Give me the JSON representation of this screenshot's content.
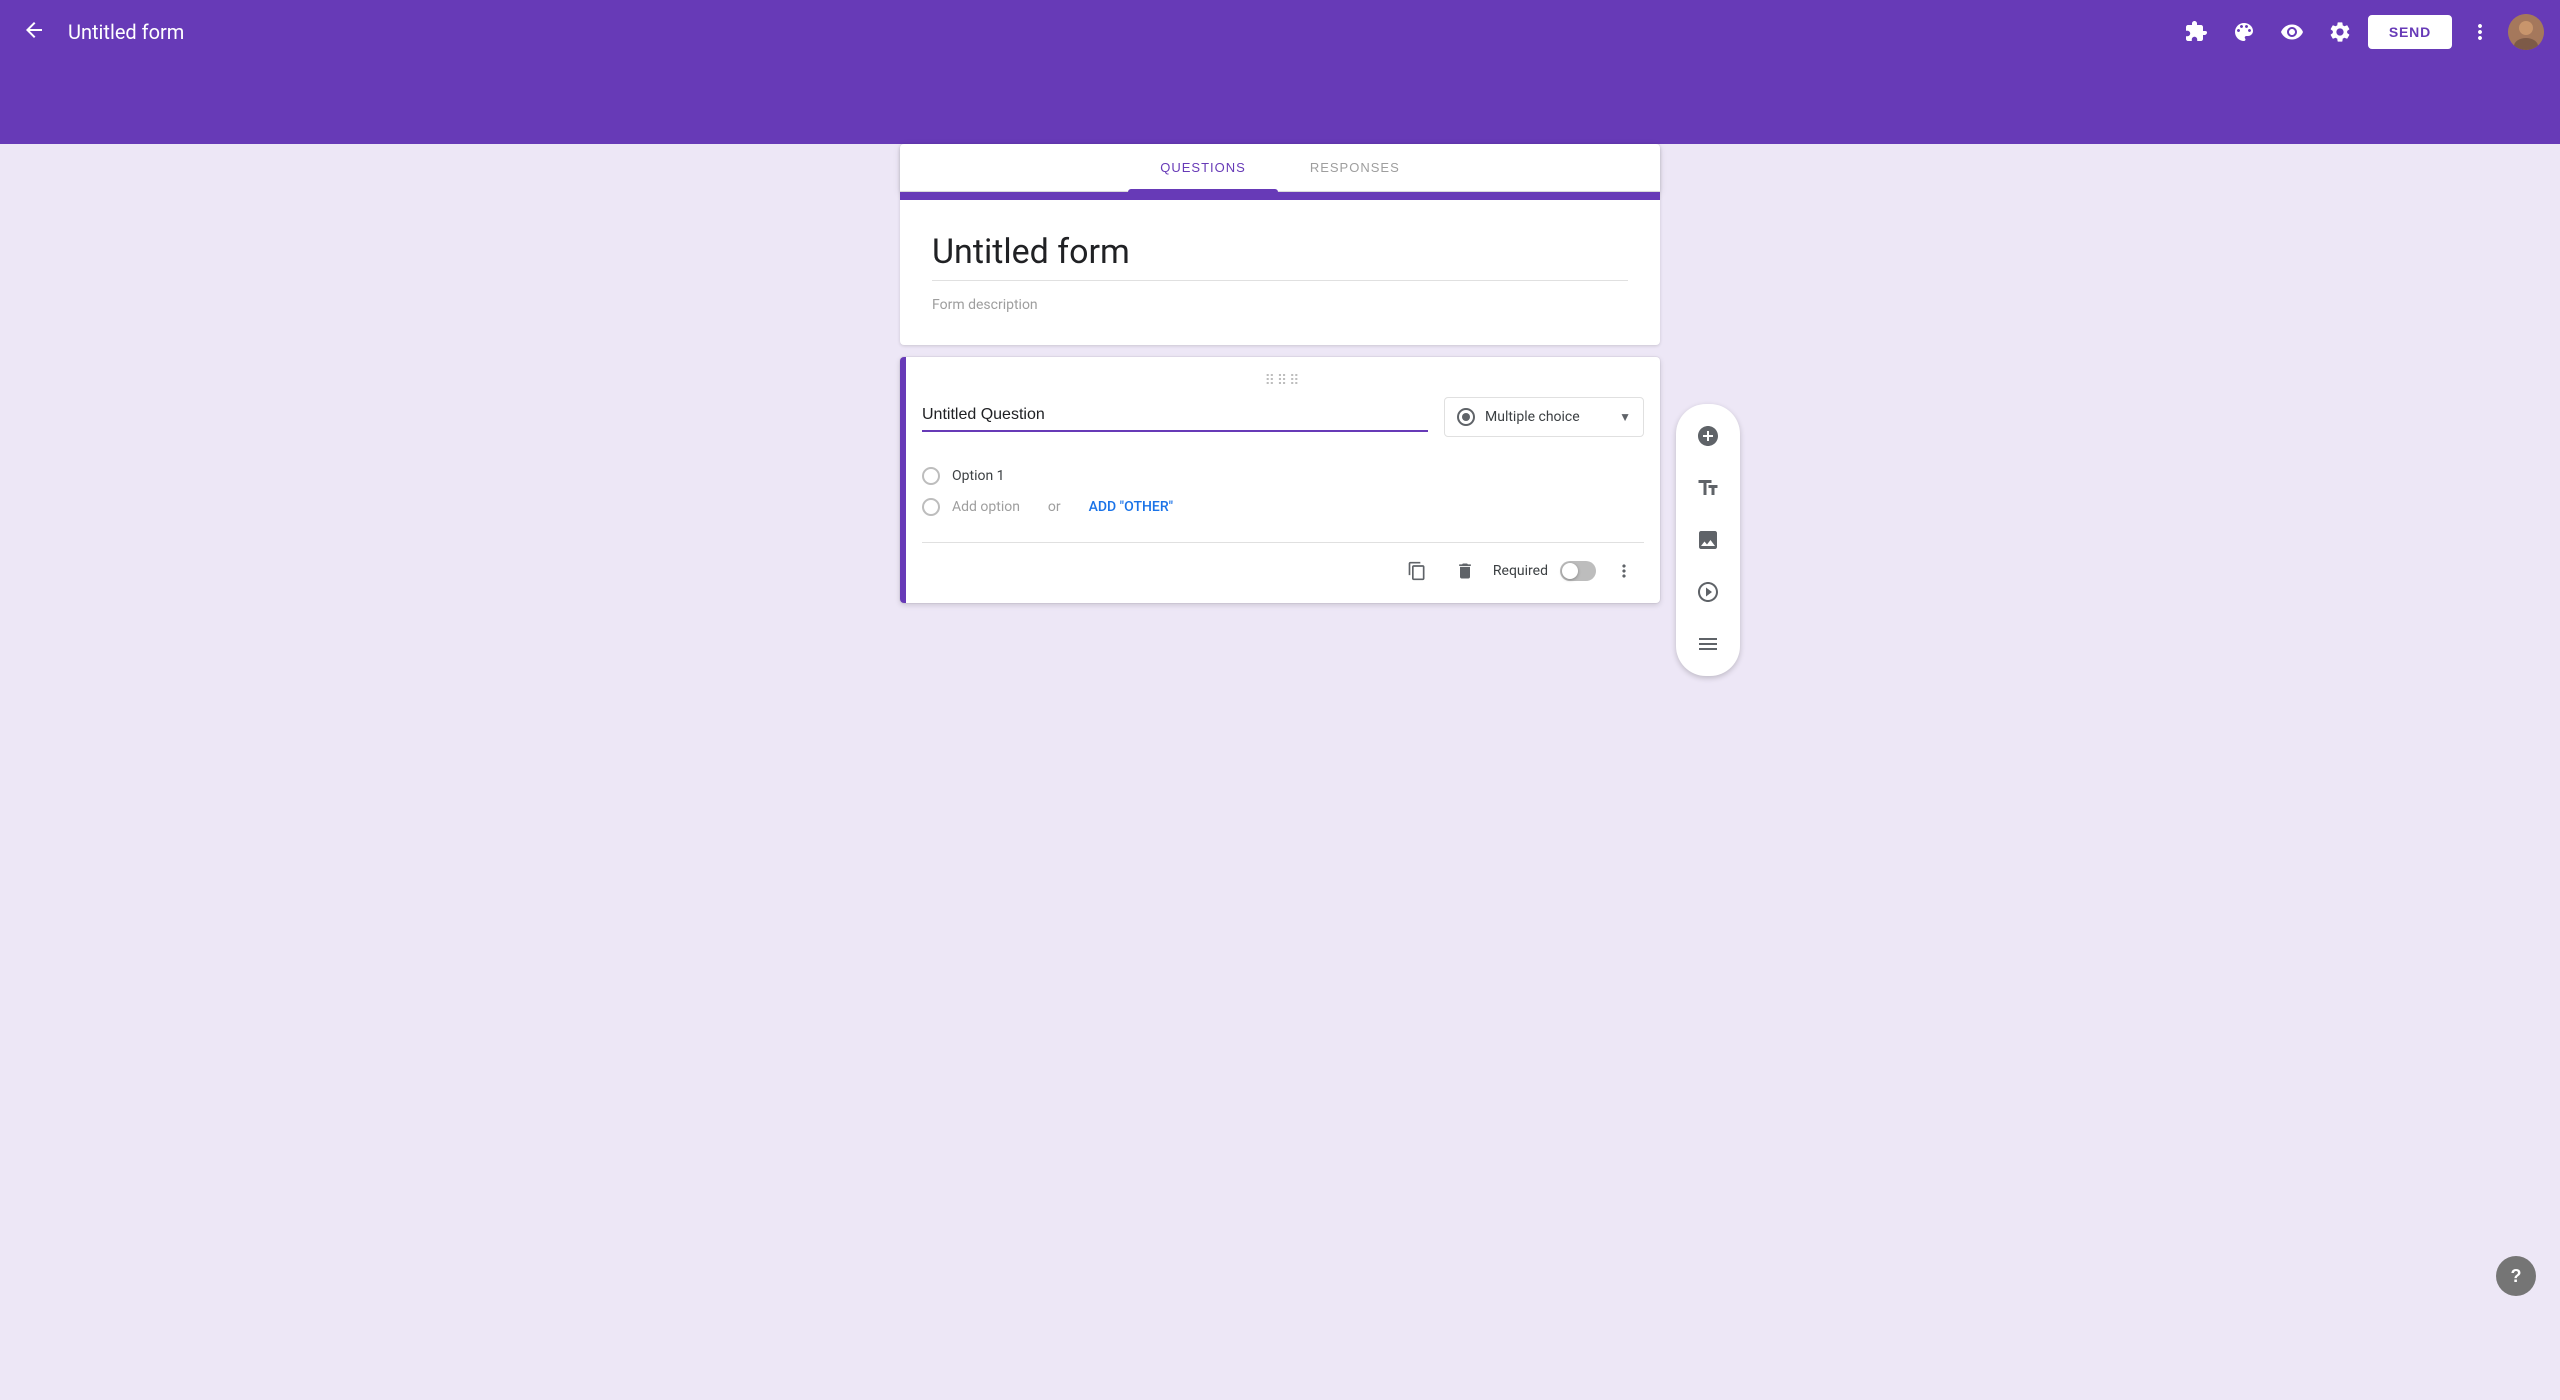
{
  "app": {
    "title": "Untitled form",
    "back_icon": "←",
    "send_label": "SEND"
  },
  "nav_icons": {
    "puzzle": "puzzle-icon",
    "palette": "palette-icon",
    "eye": "eye-icon",
    "settings": "settings-icon",
    "more": "more-icon"
  },
  "tabs": [
    {
      "id": "questions",
      "label": "QUESTIONS",
      "active": true
    },
    {
      "id": "responses",
      "label": "RESPONSES",
      "active": false
    }
  ],
  "form": {
    "title": "Untitled form",
    "description_placeholder": "Form description"
  },
  "question": {
    "drag_handle": "⠿⠿",
    "title": "Untitled Question",
    "type_label": "Multiple choice",
    "options": [
      {
        "label": "Option 1"
      }
    ],
    "add_option_text": "Add option",
    "add_option_or": "or",
    "add_other_label": "ADD \"OTHER\"",
    "required_label": "Required"
  },
  "sidebar": {
    "add_question_title": "Add question",
    "add_title_description_title": "Add title and description",
    "add_image_title": "Add image",
    "add_video_title": "Add video",
    "add_section_title": "Add section"
  },
  "footer": {
    "copy_title": "Duplicate",
    "delete_title": "Delete",
    "more_title": "More options"
  },
  "help_label": "?"
}
